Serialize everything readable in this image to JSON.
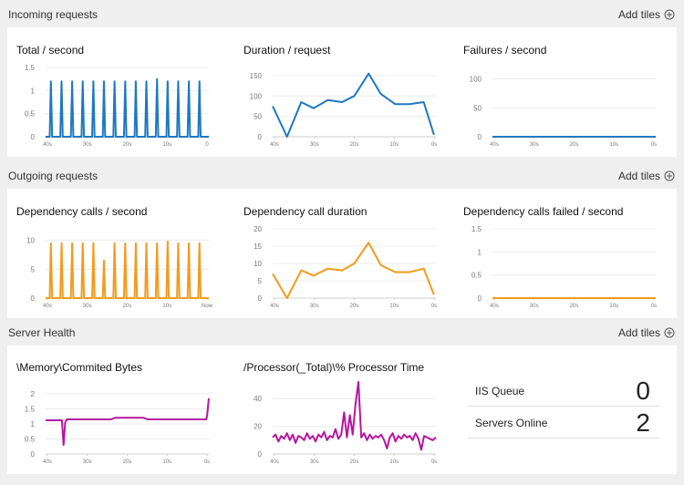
{
  "sections": {
    "incoming": {
      "title": "Incoming requests",
      "add": "Add tiles"
    },
    "outgoing": {
      "title": "Outgoing requests",
      "add": "Add tiles"
    },
    "server": {
      "title": "Server Health",
      "add": "Add tiles"
    }
  },
  "colors": {
    "blue": "#1f78c1",
    "orange": "#f29b1d",
    "purple": "#b5179e"
  },
  "charts": [
    {
      "id": "total",
      "title": "Total / second",
      "color": "#1f78c1",
      "y_ticks": [
        "1.5",
        "1",
        "0.5",
        "0"
      ],
      "x_ticks": [
        "40s",
        "30s",
        "20s",
        "10s",
        "0"
      ],
      "ylim": [
        0,
        1.5
      ],
      "x": [
        0,
        1,
        1.3,
        1.6,
        2.6,
        3.6,
        3.9,
        4.2,
        5.2,
        6.2,
        6.5,
        6.8,
        7.8,
        8.8,
        9.1,
        9.4,
        10.4,
        11.4,
        11.7,
        12,
        13,
        14,
        14.3,
        14.6,
        15.6,
        16.6,
        16.9,
        17.2,
        18.2,
        19.2,
        19.5,
        19.8,
        20.8,
        21.8,
        22.1,
        22.4,
        23.4,
        24.4,
        24.7,
        25,
        26,
        27,
        27.3,
        27.6,
        28.6,
        29.6,
        29.9,
        30.2,
        31.2,
        32.2,
        32.5,
        32.8,
        33.8,
        34.8,
        35.1,
        35.4,
        36.4,
        37.4,
        37.7,
        38,
        39,
        40
      ],
      "xlim": [
        0,
        40
      ],
      "y": [
        0,
        0,
        1.2,
        0,
        0,
        0,
        1.2,
        0,
        0,
        0,
        1.2,
        0,
        0,
        0,
        1.2,
        0,
        0,
        0,
        1.2,
        0,
        0,
        0,
        1.2,
        0,
        0,
        0,
        1.2,
        0,
        0,
        0,
        1.2,
        0,
        0,
        0,
        1.2,
        0,
        0,
        0,
        1.2,
        0,
        0,
        0,
        1.25,
        0,
        0,
        0,
        1.2,
        0,
        0,
        0,
        1.2,
        0,
        0,
        0,
        1.2,
        0,
        0,
        0,
        1.2,
        0,
        0,
        0
      ]
    },
    {
      "id": "duration",
      "title": "Duration / request",
      "color": "#1f78c1",
      "y_ticks": [
        "150",
        "100",
        "50",
        "0"
      ],
      "x_ticks": [
        "40s",
        "30s",
        "20s",
        "10s",
        "0s"
      ],
      "ylim": [
        0,
        170
      ],
      "xlim": [
        0,
        40
      ],
      "x": [
        0,
        3.5,
        7,
        10,
        13.5,
        17,
        20,
        23.5,
        26.5,
        30,
        33.5,
        37,
        39.5
      ],
      "y": [
        75,
        0,
        85,
        70,
        90,
        85,
        100,
        155,
        105,
        80,
        80,
        85,
        5
      ]
    },
    {
      "id": "failures",
      "title": "Failures / second",
      "color": "#1f78c1",
      "y_ticks": [
        "100",
        "50",
        "0"
      ],
      "x_ticks": [
        "40s",
        "30s",
        "20s",
        "10s",
        "0s"
      ],
      "ylim": [
        0,
        120
      ],
      "xlim": [
        0,
        40
      ],
      "x": [
        0,
        40
      ],
      "y": [
        0,
        0
      ]
    },
    {
      "id": "dep_calls",
      "title": "Dependency calls / second",
      "color": "#f29b1d",
      "y_ticks": [
        "10",
        "5",
        "0"
      ],
      "x_ticks": [
        "40s",
        "30s",
        "20s",
        "10s",
        "Now"
      ],
      "ylim": [
        0,
        12
      ],
      "xlim": [
        0,
        40
      ],
      "x": [
        0,
        1,
        1.3,
        1.6,
        2.6,
        3.6,
        3.9,
        4.2,
        5.2,
        6.2,
        6.5,
        6.8,
        7.8,
        8.8,
        9.1,
        9.4,
        10.4,
        11.4,
        11.7,
        12,
        13,
        14,
        14.3,
        14.6,
        15.6,
        16.6,
        16.9,
        17.2,
        18.2,
        19.2,
        19.5,
        19.8,
        20.8,
        21.8,
        22.1,
        22.4,
        23.4,
        24.4,
        24.7,
        25,
        26,
        27,
        27.3,
        27.6,
        28.6,
        29.6,
        29.9,
        30.2,
        31.2,
        32.2,
        32.5,
        32.8,
        33.8,
        34.8,
        35.1,
        35.4,
        36.4,
        37.4,
        37.7,
        38,
        39,
        40
      ],
      "y": [
        0,
        0,
        9.5,
        0,
        0,
        0,
        9.5,
        0,
        0,
        0,
        9.5,
        0,
        0,
        0,
        9.5,
        0,
        0,
        0,
        9.5,
        0,
        0,
        0,
        6.5,
        0,
        0,
        0,
        9.5,
        0,
        0,
        0,
        9.5,
        0,
        0,
        0,
        9.5,
        0,
        0,
        0,
        9.5,
        0,
        0,
        0,
        9.5,
        0,
        0,
        0,
        9.8,
        0,
        0,
        0,
        9.5,
        0,
        0,
        0,
        9.5,
        0,
        0,
        0,
        9.5,
        0,
        0,
        0
      ]
    },
    {
      "id": "dep_duration",
      "title": "Dependency call duration",
      "color": "#f29b1d",
      "y_ticks": [
        "20",
        "15",
        "10",
        "5",
        "0"
      ],
      "x_ticks": [
        "40s",
        "30s",
        "20s",
        "10s",
        "0s"
      ],
      "ylim": [
        0,
        20
      ],
      "xlim": [
        0,
        40
      ],
      "x": [
        0,
        3.5,
        7,
        10,
        13.5,
        17,
        20,
        23.5,
        26.5,
        30,
        33.5,
        37,
        39.5
      ],
      "y": [
        7,
        0,
        8,
        6.5,
        8.5,
        8,
        10,
        16,
        9.5,
        7.5,
        7.5,
        8.5,
        1
      ]
    },
    {
      "id": "dep_failed",
      "title": "Dependency calls failed / second",
      "color": "#f29b1d",
      "y_ticks": [
        "1.5",
        "1",
        "0.5",
        "0"
      ],
      "x_ticks": [
        "40s",
        "30s",
        "20s",
        "10s",
        "0s"
      ],
      "ylim": [
        0,
        1.5
      ],
      "xlim": [
        0,
        40
      ],
      "x": [
        0,
        40
      ],
      "y": [
        0,
        0
      ]
    },
    {
      "id": "memory",
      "title": "\\Memory\\Commited Bytes",
      "color": "#b5179e",
      "y_ticks": [
        "2",
        "1.5",
        "1",
        "0.5",
        "0"
      ],
      "x_ticks": [
        "40s",
        "30s",
        "20s",
        "10s",
        "0s"
      ],
      "ylim": [
        0,
        2.3
      ],
      "xlim": [
        0,
        40
      ],
      "x": [
        0,
        4,
        4.4,
        4.8,
        5.2,
        16,
        17,
        24,
        25,
        39.4,
        39.6,
        40
      ],
      "y": [
        1.12,
        1.12,
        0.3,
        1.05,
        1.15,
        1.15,
        1.2,
        1.2,
        1.15,
        1.15,
        1.3,
        1.85
      ]
    },
    {
      "id": "processor",
      "title": "/Processor(_Total)\\% Processor Time",
      "color": "#b5179e",
      "y_ticks": [
        "40",
        "20",
        "0"
      ],
      "x_ticks": [
        "40s",
        "30s",
        "20s",
        "10s",
        "0s"
      ],
      "ylim": [
        0,
        50
      ],
      "xlim": [
        0,
        40
      ],
      "x": [
        0,
        0.7,
        1.4,
        2.1,
        2.8,
        3.5,
        4.2,
        4.9,
        5.6,
        6.3,
        7,
        7.7,
        8.4,
        9.1,
        9.8,
        10.5,
        11.2,
        11.9,
        12.6,
        13.3,
        14,
        14.7,
        15.4,
        16.1,
        16.8,
        17.5,
        18.2,
        18.9,
        19.6,
        20.3,
        21,
        21.7,
        22.4,
        23.1,
        23.8,
        24.5,
        25.2,
        25.9,
        26.6,
        27.3,
        28,
        28.7,
        29.4,
        30.1,
        30.8,
        31.5,
        32.2,
        32.9,
        33.6,
        34.3,
        35,
        35.7,
        36.4,
        37.1,
        37.8,
        38.5,
        39.2,
        40
      ],
      "y": [
        12,
        14,
        9,
        13,
        11,
        15,
        10,
        14,
        8,
        13,
        12,
        10,
        15,
        11,
        13,
        9,
        14,
        12,
        16,
        10,
        13,
        12,
        18,
        11,
        14,
        30,
        12,
        28,
        14,
        36,
        52,
        12,
        15,
        10,
        14,
        11,
        13,
        12,
        14,
        10,
        4,
        12,
        15,
        9,
        13,
        11,
        14,
        12,
        13,
        10,
        15,
        11,
        3,
        13,
        12,
        11,
        10,
        12
      ]
    }
  ],
  "metrics": [
    {
      "label": "IIS Queue",
      "value": "0"
    },
    {
      "label": "Servers Online",
      "value": "2"
    }
  ]
}
